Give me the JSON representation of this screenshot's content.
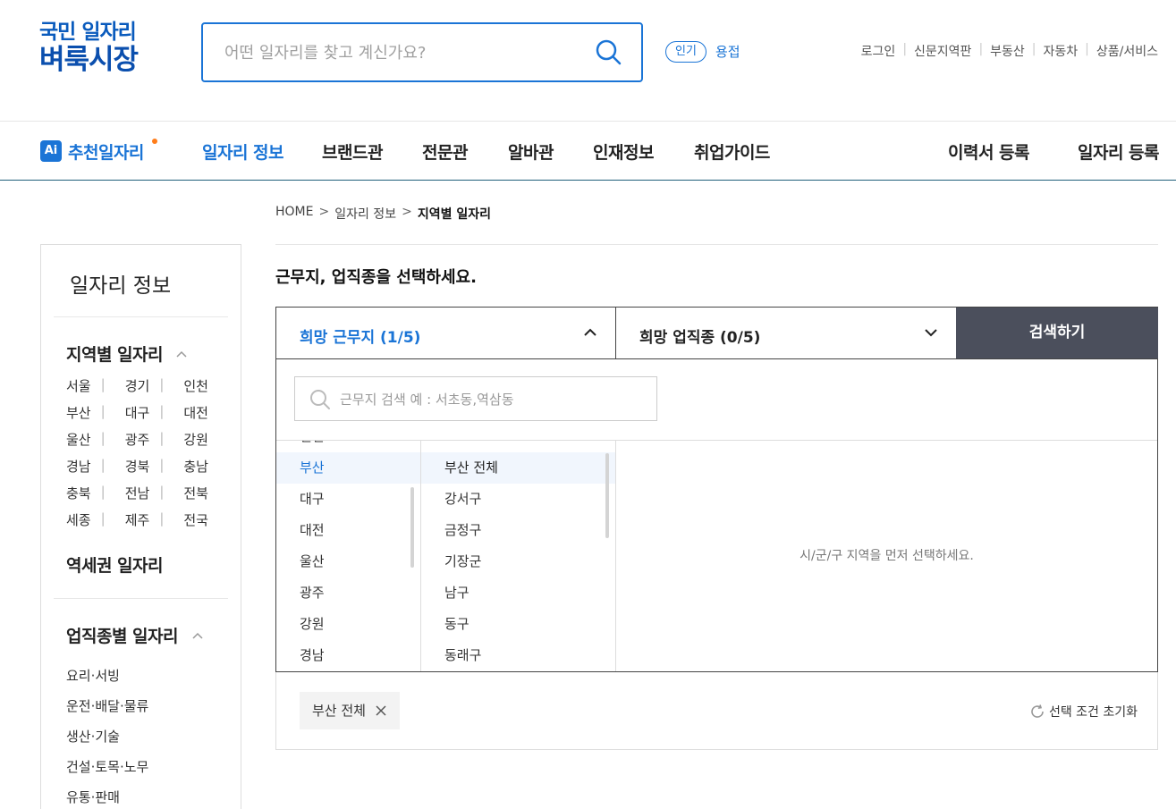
{
  "header": {
    "logo_line1": "국민 일자리",
    "logo_line2": "벼룩시장",
    "search_placeholder": "어떤 일자리를 찾고 계신가요?",
    "popular_badge": "인기",
    "popular_word": "용접",
    "util_links": [
      "로그인",
      "신문지역판",
      "부동산",
      "자동차",
      "상품/서비스"
    ]
  },
  "gnb": {
    "ai_badge": "Ai",
    "recommend": "추천일자리",
    "items": [
      "일자리 정보",
      "브랜드관",
      "전문관",
      "알바관",
      "인재정보",
      "취업가이드"
    ],
    "right_items": [
      "이력서 등록",
      "일자리 등록"
    ]
  },
  "breadcrumb": {
    "home": "HOME",
    "gt": ">",
    "level1": "일자리 정보",
    "current": "지역별 일자리"
  },
  "sidebar": {
    "title": "일자리 정보",
    "region_section": "지역별 일자리",
    "regions": [
      [
        "서울",
        "경기",
        "인천"
      ],
      [
        "부산",
        "대구",
        "대전"
      ],
      [
        "울산",
        "광주",
        "강원"
      ],
      [
        "경남",
        "경북",
        "충남"
      ],
      [
        "충북",
        "전남",
        "전북"
      ],
      [
        "세종",
        "제주",
        "전국"
      ]
    ],
    "separator": "|",
    "station_section": "역세권 일자리",
    "job_section": "업직종별 일자리",
    "jobs": [
      "요리·서빙",
      "운전·배달·물류",
      "생산·기술",
      "건설·토목·노무",
      "유통·판매"
    ]
  },
  "main": {
    "prompt": "근무지, 업직종을 선택하세요.",
    "tab_location": "희망 근무지 (1/5)",
    "tab_job": "희망 업직종 (0/5)",
    "search_button": "검색하기",
    "location_search_placeholder": "근무지 검색 예 : 서초동,역삼동",
    "regions": [
      "인천",
      "부산",
      "대구",
      "대전",
      "울산",
      "광주",
      "강원",
      "경남"
    ],
    "selected_region": "부산",
    "districts": [
      "부산 전체",
      "강서구",
      "금정구",
      "기장군",
      "남구",
      "동구",
      "동래구"
    ],
    "selected_district": "부산 전체",
    "hint": "시/군/구 지역을 먼저 선택하세요.",
    "chip": "부산 전체",
    "reset": "선택 조건 초기화"
  },
  "colors": {
    "brand_blue": "#1a74d6",
    "search_button_bg": "#4b4f5c",
    "accent_dot": "#ff7d1a"
  }
}
